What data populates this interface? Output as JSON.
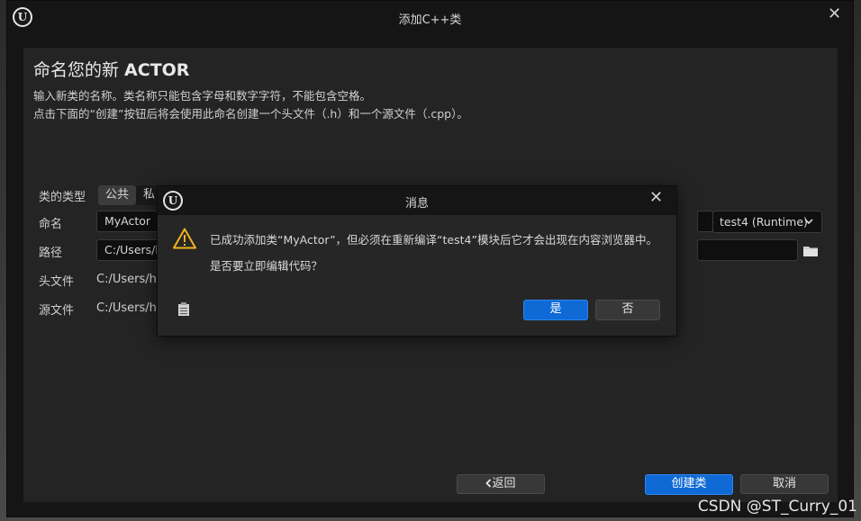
{
  "window": {
    "title": "添加C++类",
    "heading_prefix": "命名您的新 ",
    "heading_class": "ACTOR",
    "desc_line1": "输入新类的名称。类名称只能包含字母和数字字符，不能包含空格。",
    "desc_line2": "点击下面的“创建”按钮后将会使用此命名创建一个头文件（.h）和一个源文件（.cpp）。"
  },
  "form": {
    "class_type_label": "类的类型",
    "class_type_options": [
      "公共",
      "私"
    ],
    "name_label": "命名",
    "name_value": "MyActor",
    "module_dropdown": "test4 (Runtime)",
    "path_label": "路径",
    "path_value": "C:/Users/h",
    "header_label": "头文件",
    "header_value": "C:/Users/hu",
    "source_label": "源文件",
    "source_value": "C:/Users/hu"
  },
  "footer": {
    "back_label": "返回",
    "create_label": "创建类",
    "cancel_label": "取消"
  },
  "modal": {
    "title": "消息",
    "message_line1": "已成功添加类“MyActor”，但必须在重新编译“test4”模块后它才会出现在内容浏览器中。",
    "message_line2": "是否要立即编辑代码？",
    "yes_label": "是",
    "no_label": "否"
  },
  "watermark": "CSDN @ST_Curry_01",
  "colors": {
    "accent_blue": "#0f6ad6",
    "warning_yellow": "#f0b41e",
    "panel_bg": "#242424",
    "titlebar_bg": "#151515"
  },
  "icons": [
    "unreal-logo-icon",
    "close-icon",
    "warning-icon",
    "clipboard-icon",
    "folder-icon",
    "chevron-down-icon",
    "chevron-left-icon"
  ]
}
